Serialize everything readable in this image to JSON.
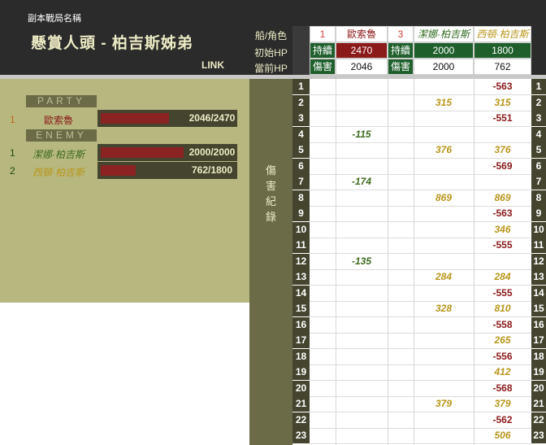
{
  "header": {
    "dungeon_label": "副本戰局名稱",
    "title": "懸賞人頭 - 柏吉斯姊弟",
    "link": "LINK"
  },
  "mid_labels": {
    "ship_role": "船/角色",
    "initial_hp": "初始HP",
    "current_hp": "當前HP",
    "damage_log": [
      "傷",
      "害",
      "紀",
      "錄"
    ]
  },
  "party": {
    "section": "PARTY",
    "members": [
      {
        "index": "1",
        "name": "歐索魯",
        "hp_text": "2046/2470",
        "hp_fraction": 0.828
      }
    ]
  },
  "enemy": {
    "section": "ENEMY",
    "members": [
      {
        "index": "1",
        "name": "潔娜·柏吉斯",
        "hp_text": "2000/2000",
        "hp_fraction": 1.0
      },
      {
        "index": "2",
        "name": "西頓·柏吉斯",
        "hp_text": "762/1800",
        "hp_fraction": 0.423
      }
    ]
  },
  "grid_header": {
    "party_slot": "1",
    "party_name": "歐索魯",
    "enemy_slot": "3",
    "enemy1_name": "潔娜·柏吉斯",
    "enemy2_name": "西頓·柏吉斯",
    "party_initial_hp": "2470",
    "party_current_hp": "2046",
    "enemy1_initial_hp": "2000",
    "enemy1_current_hp": "2000",
    "enemy2_initial_hp": "1800",
    "enemy2_current_hp": "762",
    "cont_dmg_label_a": "持續",
    "cont_dmg_label_b": "傷害"
  },
  "damage_rows": [
    {
      "row": "1",
      "party": "",
      "enemy1": "",
      "enemy2": "-563"
    },
    {
      "row": "2",
      "party": "",
      "enemy1": "315",
      "enemy2": "315"
    },
    {
      "row": "3",
      "party": "",
      "enemy1": "",
      "enemy2": "-551"
    },
    {
      "row": "4",
      "party": "-115",
      "enemy1": "",
      "enemy2": ""
    },
    {
      "row": "5",
      "party": "",
      "enemy1": "376",
      "enemy2": "376"
    },
    {
      "row": "6",
      "party": "",
      "enemy1": "",
      "enemy2": "-569"
    },
    {
      "row": "7",
      "party": "-174",
      "enemy1": "",
      "enemy2": ""
    },
    {
      "row": "8",
      "party": "",
      "enemy1": "869",
      "enemy2": "869"
    },
    {
      "row": "9",
      "party": "",
      "enemy1": "",
      "enemy2": "-563"
    },
    {
      "row": "10",
      "party": "",
      "enemy1": "",
      "enemy2": "346"
    },
    {
      "row": "11",
      "party": "",
      "enemy1": "",
      "enemy2": "-555"
    },
    {
      "row": "12",
      "party": "-135",
      "enemy1": "",
      "enemy2": ""
    },
    {
      "row": "13",
      "party": "",
      "enemy1": "284",
      "enemy2": "284"
    },
    {
      "row": "14",
      "party": "",
      "enemy1": "",
      "enemy2": "-555"
    },
    {
      "row": "15",
      "party": "",
      "enemy1": "328",
      "enemy2": "810"
    },
    {
      "row": "16",
      "party": "",
      "enemy1": "",
      "enemy2": "-558"
    },
    {
      "row": "17",
      "party": "",
      "enemy1": "",
      "enemy2": "265"
    },
    {
      "row": "18",
      "party": "",
      "enemy1": "",
      "enemy2": "-556"
    },
    {
      "row": "19",
      "party": "",
      "enemy1": "",
      "enemy2": "412"
    },
    {
      "row": "20",
      "party": "",
      "enemy1": "",
      "enemy2": "-568"
    },
    {
      "row": "21",
      "party": "",
      "enemy1": "379",
      "enemy2": "379"
    },
    {
      "row": "22",
      "party": "",
      "enemy1": "",
      "enemy2": "-562"
    },
    {
      "row": "23",
      "party": "",
      "enemy1": "",
      "enemy2": "506"
    }
  ],
  "colors": {
    "dark_header": "#2b2b2b",
    "olive_panel": "#b7b87f",
    "olive_dark": "#6b6b48",
    "row_number_bg": "#45452f",
    "party_header_red": "#8b1a1a",
    "enemy_header_green": "#1f5f2c",
    "hp_bar_red": "#8b2323",
    "negative_text": "#8b1a1a",
    "party_dmg_green": "#3d6b1f",
    "enemy_dmg_gold": "#b8961a"
  }
}
